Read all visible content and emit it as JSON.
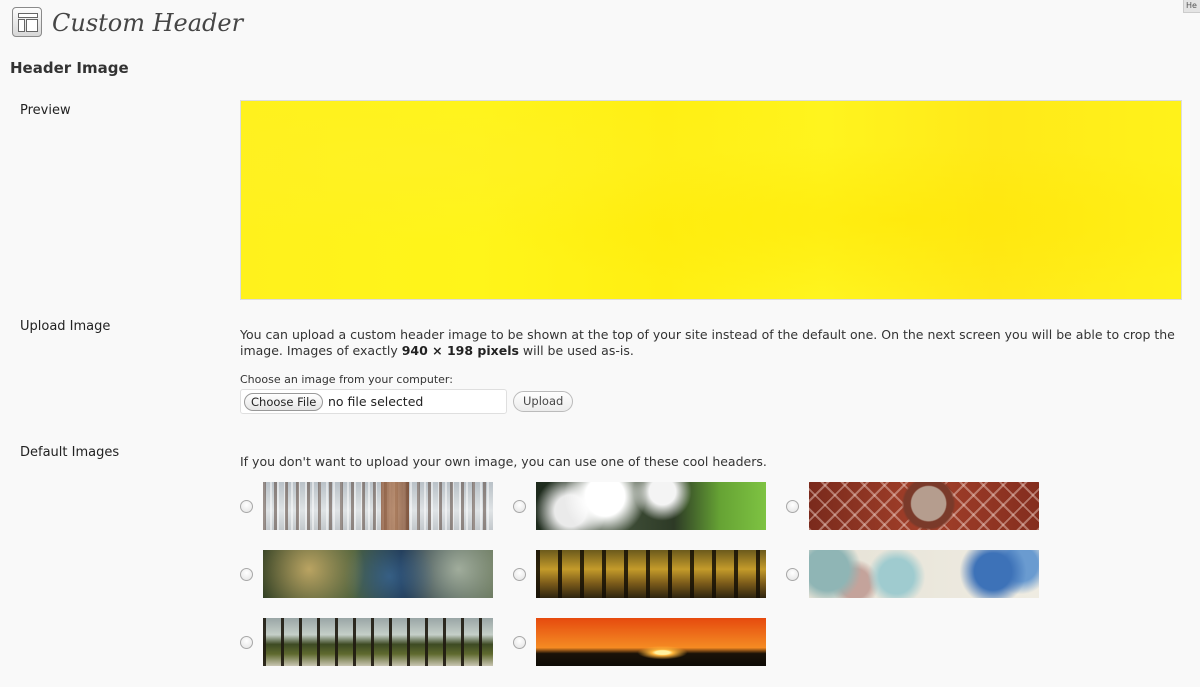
{
  "help_tab": {
    "label": "He"
  },
  "header": {
    "title": "Custom Header",
    "icon": "appearance-header-icon"
  },
  "section": {
    "title": "Header Image"
  },
  "preview": {
    "label": "Preview",
    "color": "#fff21a"
  },
  "upload": {
    "label": "Upload Image",
    "description_before": "You can upload a custom header image to be shown at the top of your site instead of the default one. On the next screen you will be able to crop the image.",
    "description_images_prefix": "Images of exactly",
    "description_dimensions": "940 × 198 pixels",
    "description_suffix": "will be used as-is.",
    "choose_label": "Choose an image from your computer:",
    "choose_file_button": "Choose File",
    "file_status": "no file selected",
    "upload_button": "Upload"
  },
  "defaults": {
    "label": "Default Images",
    "description": "If you don't want to upload your own image, you can use one of these cool headers.",
    "images": [
      {
        "name": "snowy-forest",
        "selected": false
      },
      {
        "name": "cherry-blossom",
        "selected": false
      },
      {
        "name": "red-pattern",
        "selected": false
      },
      {
        "name": "fern",
        "selected": false
      },
      {
        "name": "forest-sunlight",
        "selected": false
      },
      {
        "name": "watercolor-wordpress",
        "selected": false
      },
      {
        "name": "tree-avenue",
        "selected": false
      },
      {
        "name": "sunset",
        "selected": false
      }
    ]
  }
}
